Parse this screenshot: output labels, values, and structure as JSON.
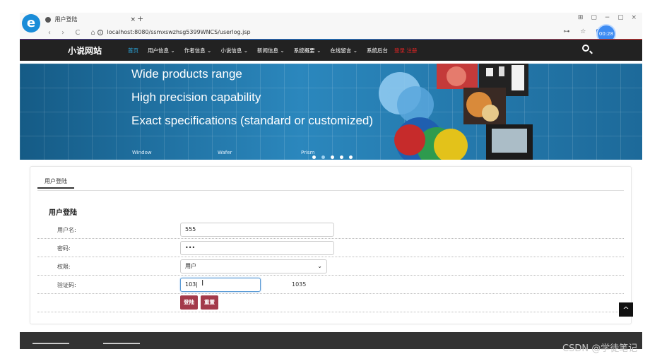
{
  "browser": {
    "tab_title": "用户登陆",
    "tab_close": "×",
    "new_tab": "+",
    "nav_buttons": "‹ › C ⌂",
    "url": "localhost:8080/ssmxswzhsg5399WNCS/userlog.jsp",
    "timer": "00:28"
  },
  "site": {
    "logo": "小说网站",
    "menu": [
      "首页",
      "用户信息 ⌄",
      "作者信息 ⌄",
      "小说信息 ⌄",
      "新闻信息 ⌄",
      "系统概要 ⌄",
      "在线留言 ⌄",
      "系统后台"
    ],
    "login_register": "登录 注册"
  },
  "banner": {
    "lines": [
      "Wide products range",
      "High precision capability",
      "Exact specifications (standard or customized)"
    ],
    "captions": [
      "Window",
      "Wafer",
      "Prism"
    ]
  },
  "panel": {
    "tab": "用户登陆",
    "form_title": "用户登陆",
    "fields": {
      "username_label": "用户名:",
      "username_value": "555",
      "password_label": "密码:",
      "password_value": "•••",
      "role_label": "权限:",
      "role_value": "用户",
      "captcha_label": "验证码:",
      "captcha_value": "103|",
      "captcha_code": "1035"
    },
    "login_button": "登陆",
    "reset_button": "重置"
  },
  "back_to_top": "^",
  "watermark": "CSDN @学徒笔记"
}
